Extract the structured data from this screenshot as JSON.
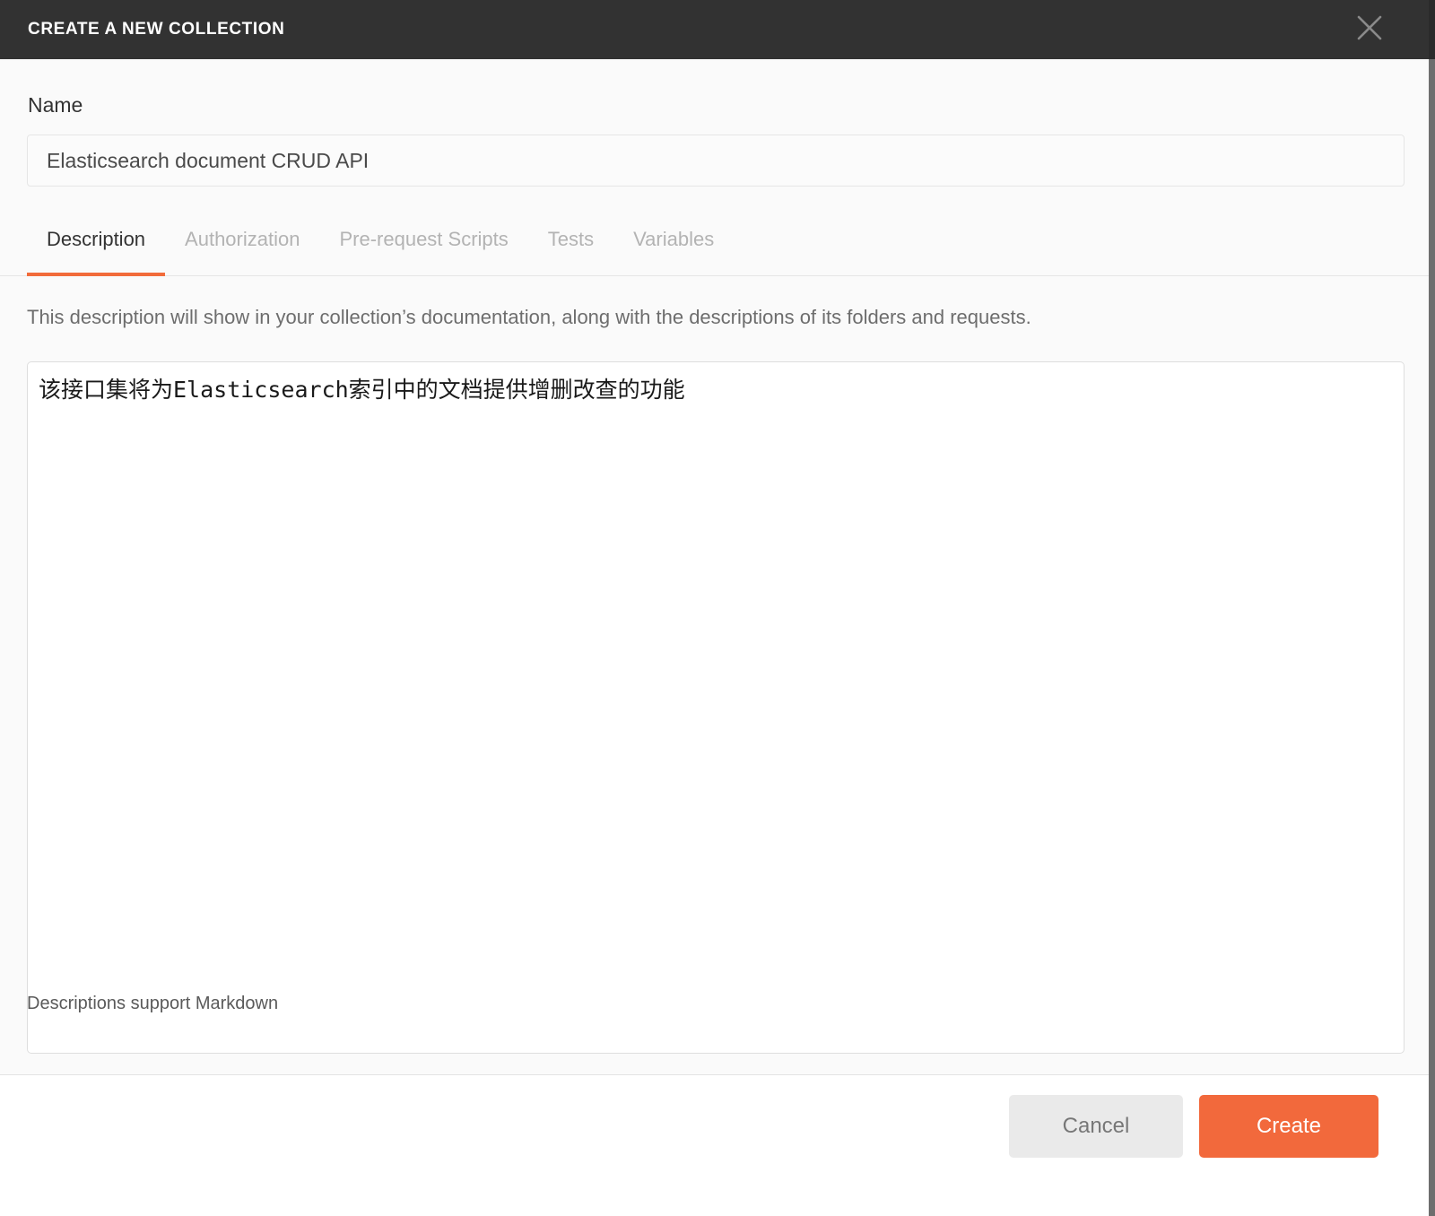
{
  "header": {
    "title": "CREATE A NEW COLLECTION",
    "close_icon": "close-icon"
  },
  "form": {
    "name_label": "Name",
    "name_value": "Elasticsearch document CRUD API",
    "name_placeholder": "Name"
  },
  "tabs": [
    {
      "label": "Description",
      "active": true
    },
    {
      "label": "Authorization",
      "active": false
    },
    {
      "label": "Pre-request Scripts",
      "active": false
    },
    {
      "label": "Tests",
      "active": false
    },
    {
      "label": "Variables",
      "active": false
    }
  ],
  "description": {
    "hint": "This description will show in your collection’s documentation, along with the descriptions of its folders and requests.",
    "value": "该接口集将为Elasticsearch索引中的文档提供增删改查的功能",
    "placeholder": "",
    "markdown_note": "Descriptions support Markdown"
  },
  "footer": {
    "cancel_label": "Cancel",
    "create_label": "Create"
  },
  "colors": {
    "header_bg": "#323232",
    "accent": "#f26b3a",
    "create_button": "#f2693c",
    "cancel_button": "#eaeaea",
    "page_bg": "#fafafa"
  }
}
